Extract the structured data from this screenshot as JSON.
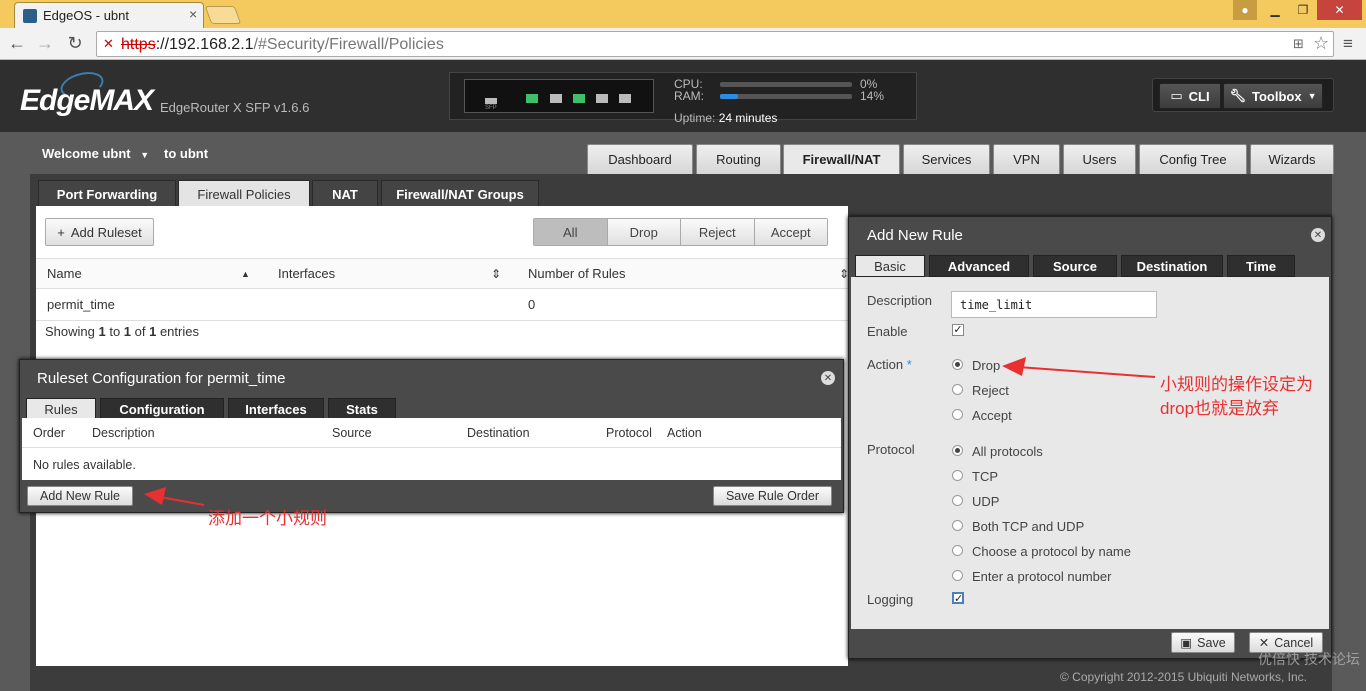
{
  "browser": {
    "tab_title": "EdgeOS - ubnt",
    "url_scheme": "https",
    "url_host": "://192.168.2.1",
    "url_path": "/#Security/Firewall/Policies"
  },
  "header": {
    "logo": "EdgeMAX",
    "model": "EdgeRouter X SFP v1.6.6",
    "cpu_label": "CPU:",
    "cpu_value": "0%",
    "cpu_fraction": 0.0,
    "ram_label": "RAM:",
    "ram_value": "14%",
    "ram_fraction": 0.14,
    "uptime_label": "Uptime:",
    "uptime_value": "24 minutes",
    "sfp_label": "SFP",
    "cli_label": "CLI",
    "toolbox_label": "Toolbox"
  },
  "user": {
    "welcome": "Welcome ubnt",
    "to": "to ubnt"
  },
  "nav": {
    "tabs": [
      "Dashboard",
      "Routing",
      "Firewall/NAT",
      "Services",
      "VPN",
      "Users",
      "Config Tree",
      "Wizards"
    ],
    "active": "Firewall/NAT"
  },
  "subtabs": {
    "items": [
      "Port Forwarding",
      "Firewall Policies",
      "NAT",
      "Firewall/NAT Groups"
    ],
    "active": "Firewall Policies"
  },
  "policies": {
    "add_ruleset_label": "Add Ruleset",
    "filters": [
      "All",
      "Drop",
      "Reject",
      "Accept"
    ],
    "active_filter": "All",
    "columns": [
      "Name",
      "Interfaces",
      "Number of Rules"
    ],
    "rows": [
      {
        "name": "permit_time",
        "interfaces": "",
        "rules": "0"
      }
    ],
    "showing_prefix": "Showing ",
    "showing_from": "1",
    "showing_to_word": " to ",
    "showing_to": "1",
    "showing_of_word": " of ",
    "showing_total": "1",
    "showing_suffix": " entries"
  },
  "ruleset_dialog": {
    "title": "Ruleset Configuration for permit_time",
    "tabs": [
      "Rules",
      "Configuration",
      "Interfaces",
      "Stats"
    ],
    "active_tab": "Rules",
    "columns": [
      "Order",
      "Description",
      "Source",
      "Destination",
      "Protocol",
      "Action"
    ],
    "empty_text": "No rules available.",
    "add_rule_label": "Add New Rule",
    "save_order_label": "Save Rule Order"
  },
  "new_rule_dialog": {
    "title": "Add New Rule",
    "tabs": [
      "Basic",
      "Advanced",
      "Source",
      "Destination",
      "Time"
    ],
    "active_tab": "Basic",
    "description_label": "Description",
    "description_value": "time_limit",
    "enable_label": "Enable",
    "enable_checked": true,
    "action_label": "Action",
    "action_required_mark": "*",
    "actions": [
      "Drop",
      "Reject",
      "Accept"
    ],
    "action_selected": "Drop",
    "protocol_label": "Protocol",
    "protocols": [
      "All protocols",
      "TCP",
      "UDP",
      "Both TCP and UDP",
      "Choose a protocol by name",
      "Enter a protocol number"
    ],
    "protocol_selected": "All protocols",
    "logging_label": "Logging",
    "logging_checked": true,
    "save_label": "Save",
    "cancel_label": "Cancel"
  },
  "annotations": {
    "action_note_line1": "小规则的操作设定为",
    "action_note_line2": "drop也就是放弃",
    "add_rule_note": "添加一个小规则"
  },
  "footer": {
    "copyright": "© Copyright 2012-2015 Ubiquiti Networks, Inc.",
    "watermark": "优倍快 技术论坛"
  },
  "colors": {
    "accent": "#2b8de0",
    "annotation": "#e83030",
    "tabstrip": "#f4c95e",
    "port_active": "#3ec06a"
  }
}
